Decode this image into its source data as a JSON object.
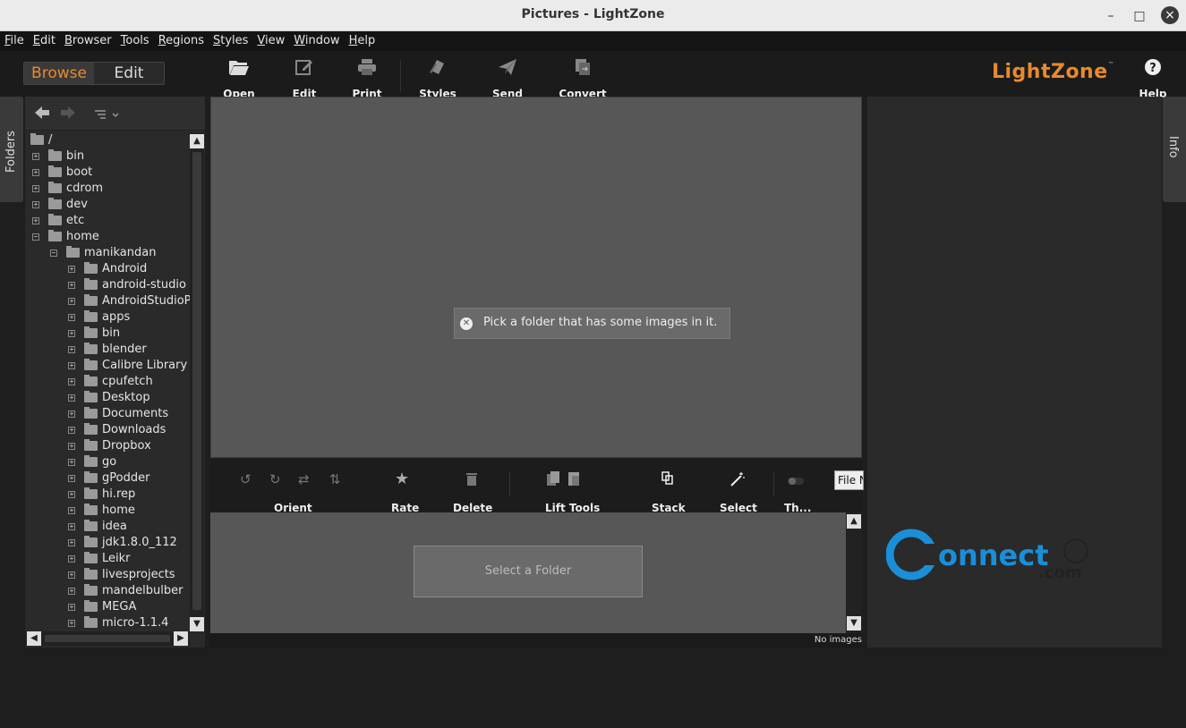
{
  "window": {
    "title": "Pictures - LightZone",
    "minimize": "–",
    "maximize": "□",
    "close": "×"
  },
  "menubar": [
    "File",
    "Edit",
    "Browser",
    "Tools",
    "Regions",
    "Styles",
    "View",
    "Window",
    "Help"
  ],
  "modes": {
    "browse": "Browse",
    "edit": "Edit"
  },
  "toolbar": {
    "open": "Open",
    "edit": "Edit",
    "print": "Print",
    "styles": "Styles",
    "send": "Send",
    "convert": "Convert",
    "help": "Help"
  },
  "brand": {
    "logo": "LightZone",
    "tm": "™",
    "accent": "#e98a2b"
  },
  "side_tabs": {
    "left": "Folders",
    "right": "Info"
  },
  "tree": {
    "root": "/",
    "items": [
      {
        "label": "bin",
        "depth": 0,
        "expander": "+"
      },
      {
        "label": "boot",
        "depth": 0,
        "expander": "+"
      },
      {
        "label": "cdrom",
        "depth": 0,
        "expander": "+"
      },
      {
        "label": "dev",
        "depth": 0,
        "expander": "+"
      },
      {
        "label": "etc",
        "depth": 0,
        "expander": "+"
      },
      {
        "label": "home",
        "depth": 0,
        "expander": "−"
      },
      {
        "label": "manikandan",
        "depth": 1,
        "expander": "−"
      },
      {
        "label": "Android",
        "depth": 2,
        "expander": "+"
      },
      {
        "label": "android-studio",
        "depth": 2,
        "expander": "+"
      },
      {
        "label": "AndroidStudioP",
        "depth": 2,
        "expander": "+"
      },
      {
        "label": "apps",
        "depth": 2,
        "expander": "+"
      },
      {
        "label": "bin",
        "depth": 2,
        "expander": "+"
      },
      {
        "label": "blender",
        "depth": 2,
        "expander": "+"
      },
      {
        "label": "Calibre Library",
        "depth": 2,
        "expander": "+"
      },
      {
        "label": "cpufetch",
        "depth": 2,
        "expander": "+"
      },
      {
        "label": "Desktop",
        "depth": 2,
        "expander": "+"
      },
      {
        "label": "Documents",
        "depth": 2,
        "expander": "+"
      },
      {
        "label": "Downloads",
        "depth": 2,
        "expander": "+"
      },
      {
        "label": "Dropbox",
        "depth": 2,
        "expander": "+"
      },
      {
        "label": "go",
        "depth": 2,
        "expander": "+"
      },
      {
        "label": "gPodder",
        "depth": 2,
        "expander": "+"
      },
      {
        "label": "hi.rep",
        "depth": 2,
        "expander": "+"
      },
      {
        "label": "home",
        "depth": 2,
        "expander": "+"
      },
      {
        "label": "idea",
        "depth": 2,
        "expander": "+"
      },
      {
        "label": "jdk1.8.0_112",
        "depth": 2,
        "expander": "+"
      },
      {
        "label": "Leikr",
        "depth": 2,
        "expander": "+"
      },
      {
        "label": "livesprojects",
        "depth": 2,
        "expander": "+"
      },
      {
        "label": "mandelbulber",
        "depth": 2,
        "expander": "+"
      },
      {
        "label": "MEGA",
        "depth": 2,
        "expander": "+"
      },
      {
        "label": "micro-1.1.4",
        "depth": 2,
        "expander": "+"
      }
    ]
  },
  "preview": {
    "message": "Pick a folder that has some images in it."
  },
  "browser_toolbar": {
    "orient": "Orient",
    "rate": "Rate",
    "delete": "Delete",
    "lift_tools": "Lift Tools",
    "stack": "Stack",
    "select": "Select",
    "thumbs": "Th...",
    "sort_field": "File N"
  },
  "browser": {
    "select_folder": "Select a Folder"
  },
  "status": {
    "text": "No images"
  },
  "watermark": {
    "word": "onnect",
    "letter": "C",
    "suffix": ".com"
  }
}
